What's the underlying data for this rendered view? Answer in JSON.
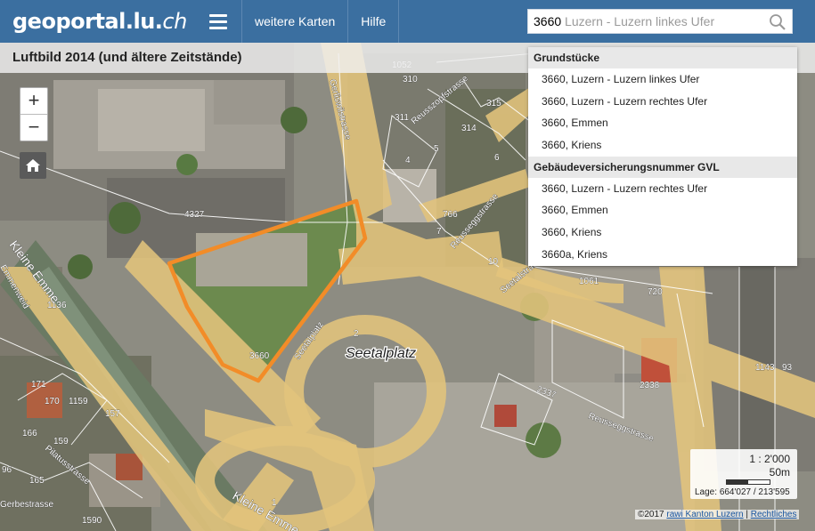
{
  "header": {
    "logo_main": "geoportal.lu.",
    "logo_suffix": "ch",
    "nav": [
      "weitere Karten",
      "Hilfe"
    ],
    "search_value": "3660",
    "search_hint": " Luzern - Luzern linkes Ufer"
  },
  "map": {
    "title": "Luftbild 2014 (und ältere Zeitstände)",
    "labels": [
      "Seetalplatz",
      "Kleine Emme",
      "Kleine Emme",
      "Seetalplatz",
      "Reussegg­strasse",
      "Gerliswilstrasse",
      "Reusszopfstrasse",
      "Seetalstrasse",
      "Reussegg­strasse",
      "Pilatusstrasse",
      "Gerbestrasse",
      "Emmenweid"
    ],
    "parcels": [
      "3660",
      "4327",
      "310",
      "311",
      "314",
      "315",
      "4",
      "5",
      "6",
      "7",
      "10",
      "766",
      "1052",
      "1061",
      "1143",
      "2338",
      "2337",
      "1136",
      "157",
      "159",
      "165",
      "166",
      "170",
      "171",
      "1159",
      "1590",
      "1",
      "2",
      "720",
      "93",
      "96"
    ]
  },
  "search_results": {
    "groups": [
      {
        "name": "Grundstücke",
        "items": [
          "3660, Luzern - Luzern linkes Ufer",
          "3660, Luzern - Luzern rechtes Ufer",
          "3660, Emmen",
          "3660, Kriens"
        ]
      },
      {
        "name": "Gebäudeversicherungsnummer GVL",
        "items": [
          "3660, Luzern - Luzern rechtes Ufer",
          "3660, Emmen",
          "3660, Kriens",
          "3660a, Kriens"
        ]
      }
    ]
  },
  "scale": {
    "ratio": "1 : 2'000",
    "distance": "50m",
    "coords_label": "Lage:",
    "coords": "664'027 / 213'595"
  },
  "copyright": {
    "prefix": "©2017",
    "source": "rawi Kanton Luzern",
    "separator": "|",
    "legal": "Rechtliches"
  },
  "colors": {
    "header": "#3b6fa0",
    "highlight": "#f28c28",
    "roads": "#e8c77e"
  }
}
